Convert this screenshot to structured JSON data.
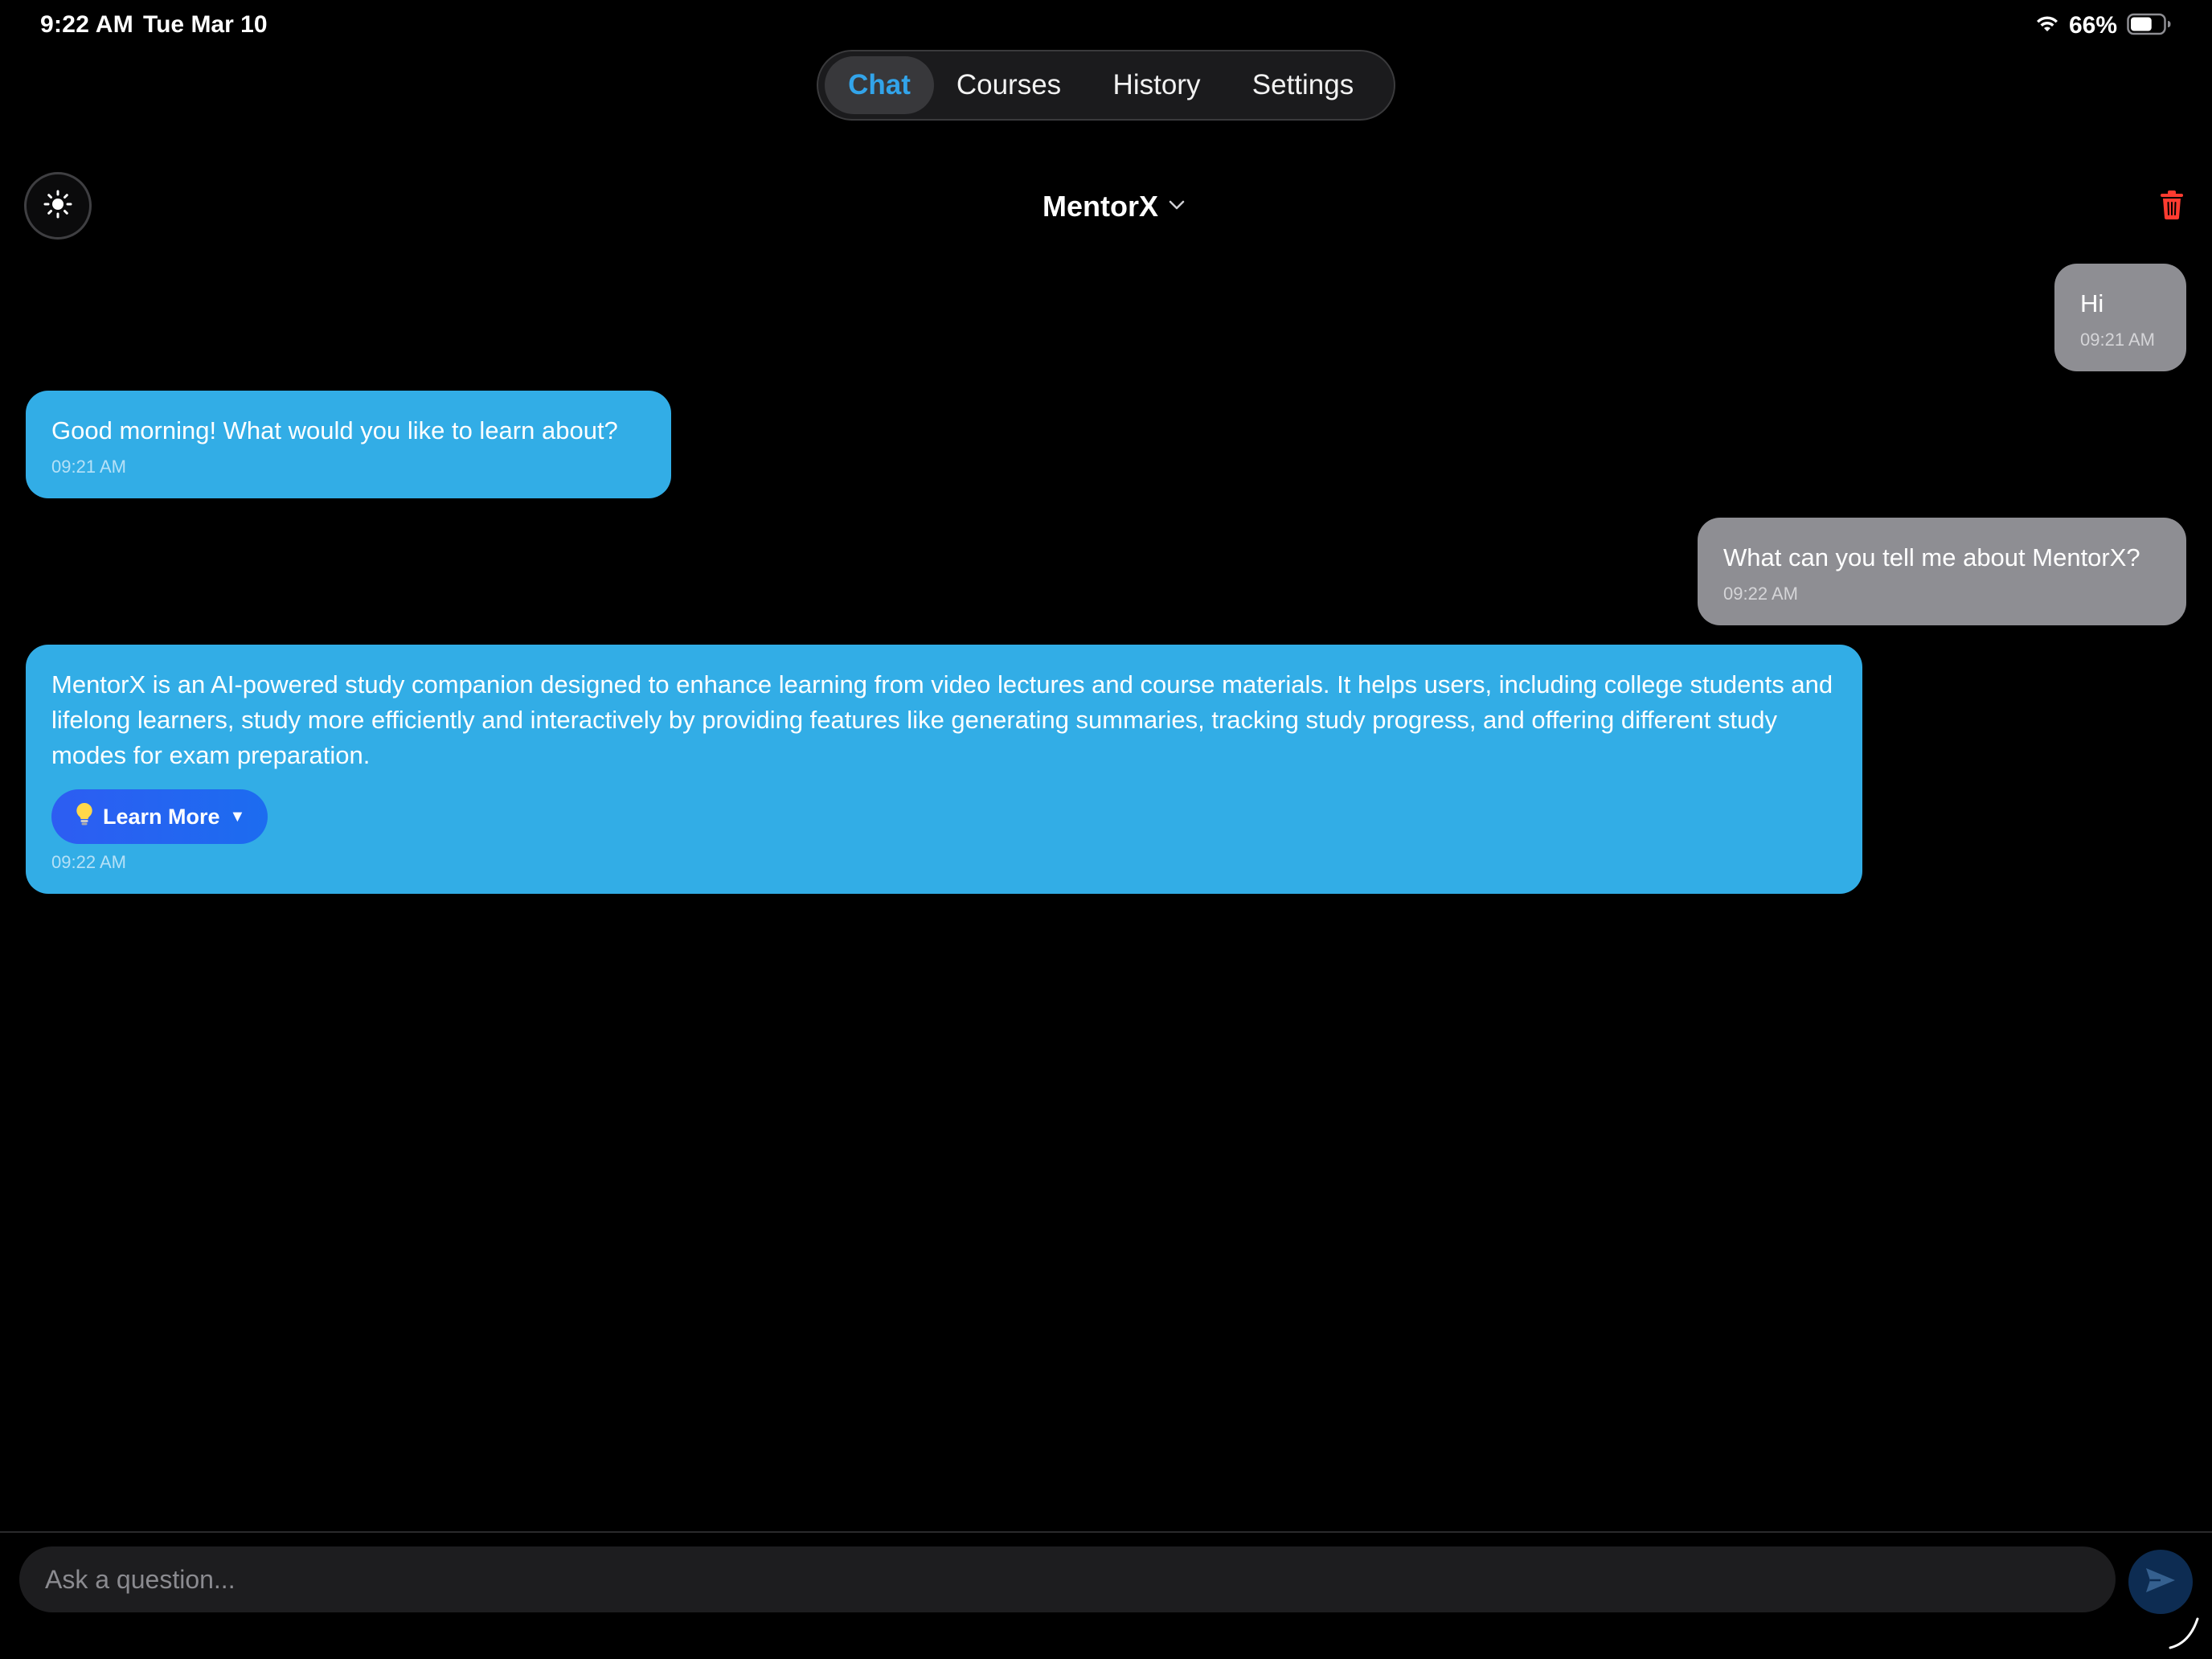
{
  "status_bar": {
    "time": "9:22 AM",
    "date": "Tue Mar 10",
    "battery_percent": "66%",
    "battery_level": 0.66,
    "wifi_icon": "wifi-icon",
    "battery_icon": "battery-icon"
  },
  "nav": {
    "tabs": [
      {
        "label": "Chat",
        "active": true
      },
      {
        "label": "Courses",
        "active": false
      },
      {
        "label": "History",
        "active": false
      },
      {
        "label": "Settings",
        "active": false
      }
    ]
  },
  "header": {
    "model_name": "MentorX",
    "theme_icon": "sun-icon",
    "delete_icon": "trash-icon"
  },
  "messages": [
    {
      "role": "user",
      "text": "Hi",
      "time": "09:21 AM"
    },
    {
      "role": "assistant",
      "text": "Good morning! What would you like to learn about?",
      "time": "09:21 AM"
    },
    {
      "role": "user",
      "text": "What can you tell me about MentorX?",
      "time": "09:22 AM"
    },
    {
      "role": "assistant",
      "text": "MentorX is an AI-powered study companion designed to enhance learning from video lectures and course materials. It helps users, including college students and lifelong learners, study more efficiently and interactively by providing features like generating summaries, tracking study progress, and offering different study modes for exam preparation.",
      "time": "09:22 AM",
      "action": {
        "label": "Learn More",
        "icon": "lightbulb-icon",
        "caret": "▼"
      }
    }
  ],
  "composer": {
    "placeholder": "Ask a question...",
    "value": "",
    "send_icon": "send-icon"
  },
  "colors": {
    "accent": "#32a4ea",
    "assistant_bubble": "#32ade6",
    "user_bubble": "#8e8e93",
    "danger": "#ff3b30",
    "learn_more_button": "#2d5df2",
    "send_button": "#0d2c52"
  }
}
